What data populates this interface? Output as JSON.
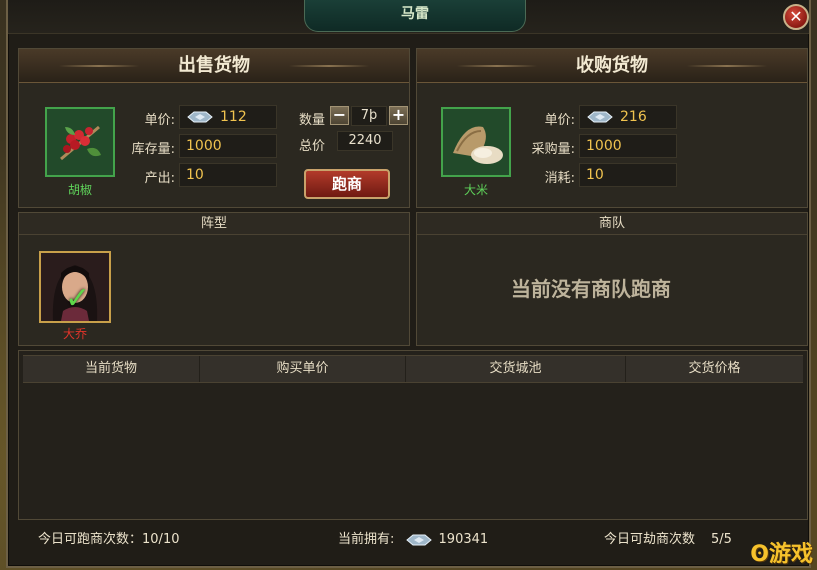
{
  "window": {
    "title": "马雷",
    "close_label": "✕"
  },
  "sell_panel": {
    "title": "出售货物",
    "item": {
      "name": "胡椒",
      "icon": "pepper-icon"
    },
    "rows": [
      {
        "label": "单价:",
        "value": "112"
      },
      {
        "label": "库存量:",
        "value": "1000"
      },
      {
        "label": "产出:",
        "value": "10"
      }
    ],
    "quantity": {
      "label": "数量",
      "value": "7þ",
      "minus": "−",
      "plus": "+"
    },
    "total": {
      "label": "总价",
      "value": "2240"
    },
    "run_button": "跑商"
  },
  "buy_panel": {
    "title": "收购货物",
    "item": {
      "name": "大米",
      "icon": "rice-icon"
    },
    "rows": [
      {
        "label": "单价:",
        "value": "216"
      },
      {
        "label": "采购量:",
        "value": "1000"
      },
      {
        "label": "消耗:",
        "value": "10"
      }
    ]
  },
  "formation": {
    "title": "阵型",
    "hero": {
      "name": "大乔",
      "selected": true
    }
  },
  "caravan": {
    "title": "商队",
    "empty_message": "当前没有商队跑商"
  },
  "table": {
    "columns": [
      "当前货物",
      "购买单价",
      "交货城池",
      "交货价格"
    ],
    "rows": []
  },
  "footer": {
    "runs_label": "今日可跑商次数：",
    "runs_value": "10/10",
    "owned_label": "当前拥有:",
    "owned_value": "190341",
    "rob_label": "今日可劫商次数",
    "rob_value": "5/5"
  },
  "watermark": "游戏",
  "colors": {
    "accent_gold": "#f0c34f",
    "item_green": "#43a34b",
    "button_red": "#b23a2a"
  }
}
